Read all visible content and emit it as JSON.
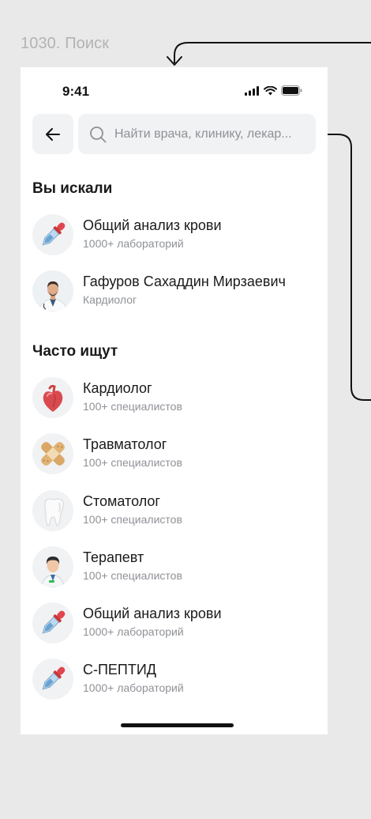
{
  "frame": {
    "label": "1030. Поиск"
  },
  "status_bar": {
    "time": "9:41"
  },
  "search": {
    "back_icon": "arrow-left-icon",
    "search_icon": "magnifier-icon",
    "placeholder": "Найти врача, клинику, лекар..."
  },
  "recent": {
    "title": "Вы искали",
    "items": [
      {
        "title": "Общий анализ крови",
        "subtitle": "1000+ лабораторий",
        "icon": "pipette-icon"
      },
      {
        "title": "Гафуров Сахаддин Мирзаевич",
        "subtitle": "Кардиолог",
        "icon": "doctor-photo"
      }
    ]
  },
  "popular": {
    "title": "Часто ищут",
    "items": [
      {
        "title": "Кардиолог",
        "subtitle": "100+ специалистов",
        "icon": "heart-icon"
      },
      {
        "title": "Травматолог",
        "subtitle": "100+ специалистов",
        "icon": "bandage-icon"
      },
      {
        "title": "Стоматолог",
        "subtitle": "100+ специалистов",
        "icon": "tooth-icon"
      },
      {
        "title": "Терапевт",
        "subtitle": "100+ специалистов",
        "icon": "therapist-icon"
      },
      {
        "title": "Общий анализ крови",
        "subtitle": "1000+ лабораторий",
        "icon": "pipette-icon"
      },
      {
        "title": "С-ПЕПТИД",
        "subtitle": "1000+ лабораторий",
        "icon": "pipette-icon"
      }
    ]
  },
  "colors": {
    "background": "#e9e9e9",
    "screen": "#ffffff",
    "field": "#f1f2f3",
    "secondary_text": "#8e9196",
    "primary_text": "#1a1a1a"
  }
}
